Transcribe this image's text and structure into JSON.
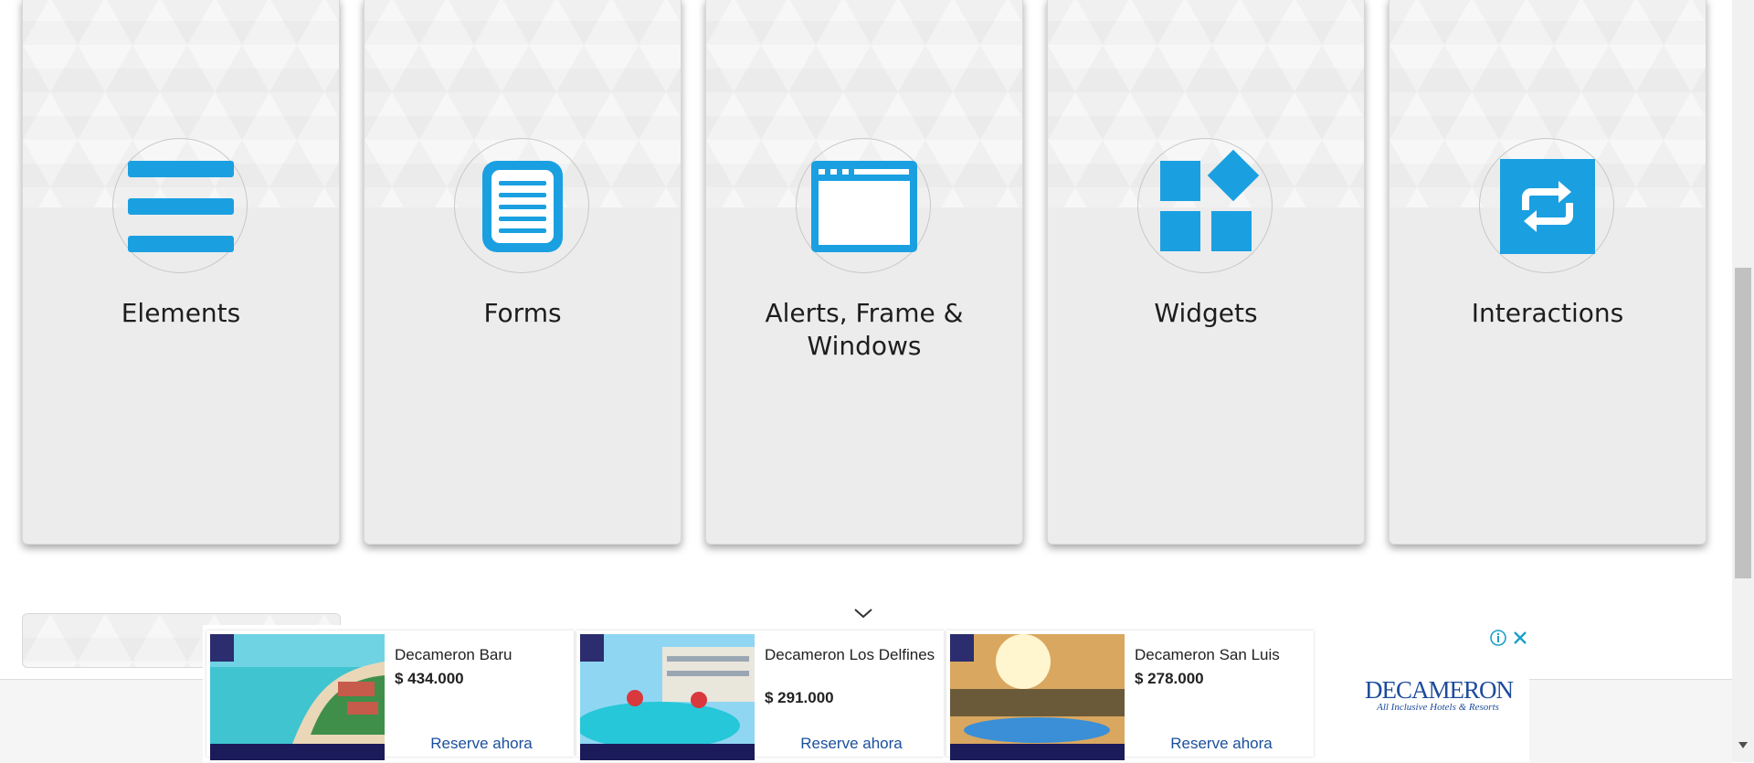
{
  "cards": [
    {
      "title": "Elements",
      "icon": "hamburger-menu-icon"
    },
    {
      "title": "Forms",
      "icon": "document-icon"
    },
    {
      "title": "Alerts, Frame & Windows",
      "icon": "browser-window-icon"
    },
    {
      "title": "Widgets",
      "icon": "widgets-icon"
    },
    {
      "title": "Interactions",
      "icon": "swap-arrows-icon"
    }
  ],
  "accent_color": "#1aa0e1",
  "ad": {
    "items": [
      {
        "name": "Decameron Baru",
        "price": "$ 434.000",
        "cta": "Reserve ahora"
      },
      {
        "name": "Decameron Los Delfines",
        "price": "$ 291.000",
        "cta": "Reserve ahora"
      },
      {
        "name": "Decameron San Luis",
        "price": "$ 278.000",
        "cta": "Reserve ahora"
      }
    ],
    "logo_text": "DECAMERON",
    "logo_subtext": "All Inclusive Hotels & Resorts"
  }
}
